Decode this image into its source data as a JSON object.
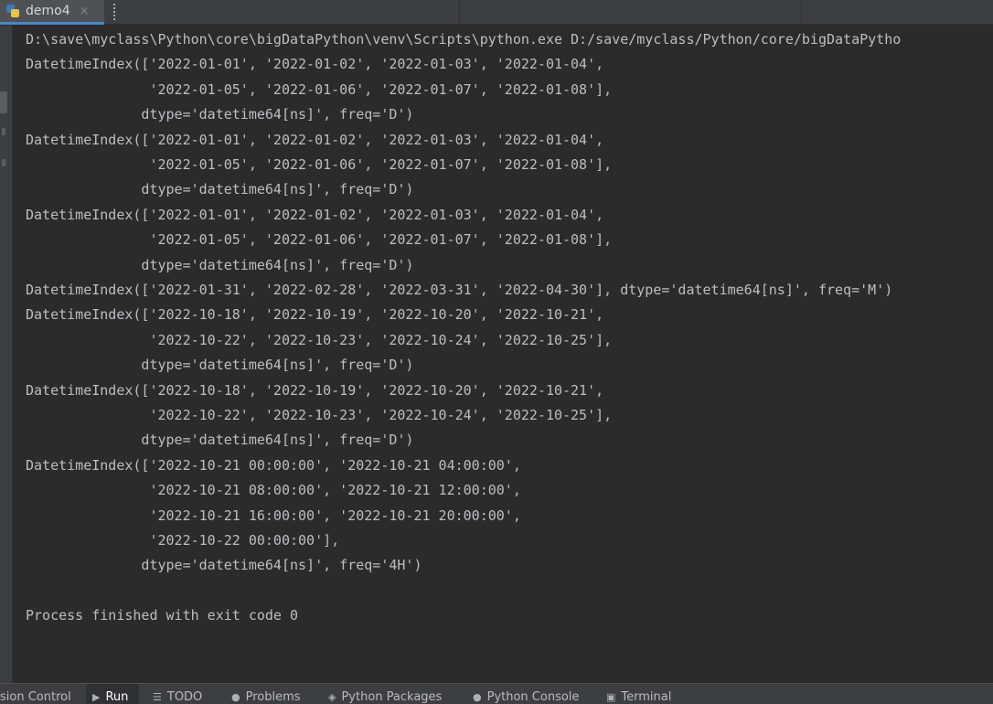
{
  "editor_tab": {
    "title": "demo4",
    "close": "×",
    "icon": "python-file-icon"
  },
  "console": {
    "lines": [
      "D:\\save\\myclass\\Python\\core\\bigDataPython\\venv\\Scripts\\python.exe D:/save/myclass/Python/core/bigDataPytho",
      "DatetimeIndex(['2022-01-01', '2022-01-02', '2022-01-03', '2022-01-04',",
      "               '2022-01-05', '2022-01-06', '2022-01-07', '2022-01-08'],",
      "              dtype='datetime64[ns]', freq='D')",
      "DatetimeIndex(['2022-01-01', '2022-01-02', '2022-01-03', '2022-01-04',",
      "               '2022-01-05', '2022-01-06', '2022-01-07', '2022-01-08'],",
      "              dtype='datetime64[ns]', freq='D')",
      "DatetimeIndex(['2022-01-01', '2022-01-02', '2022-01-03', '2022-01-04',",
      "               '2022-01-05', '2022-01-06', '2022-01-07', '2022-01-08'],",
      "              dtype='datetime64[ns]', freq='D')",
      "DatetimeIndex(['2022-01-31', '2022-02-28', '2022-03-31', '2022-04-30'], dtype='datetime64[ns]', freq='M')",
      "DatetimeIndex(['2022-10-18', '2022-10-19', '2022-10-20', '2022-10-21',",
      "               '2022-10-22', '2022-10-23', '2022-10-24', '2022-10-25'],",
      "              dtype='datetime64[ns]', freq='D')",
      "DatetimeIndex(['2022-10-18', '2022-10-19', '2022-10-20', '2022-10-21',",
      "               '2022-10-22', '2022-10-23', '2022-10-24', '2022-10-25'],",
      "              dtype='datetime64[ns]', freq='D')",
      "DatetimeIndex(['2022-10-21 00:00:00', '2022-10-21 04:00:00',",
      "               '2022-10-21 08:00:00', '2022-10-21 12:00:00',",
      "               '2022-10-21 16:00:00', '2022-10-21 20:00:00',",
      "               '2022-10-22 00:00:00'],",
      "              dtype='datetime64[ns]', freq='4H')",
      "",
      "Process finished with exit code 0"
    ]
  },
  "tool_windows": [
    {
      "label": "sion Control",
      "icon": "",
      "icon_name": "version-control-icon",
      "active": false
    },
    {
      "label": "Run",
      "icon": "▶",
      "icon_name": "run-icon",
      "active": true
    },
    {
      "label": "TODO",
      "icon": "☰",
      "icon_name": "todo-icon",
      "active": false
    },
    {
      "label": "Problems",
      "icon": "●",
      "icon_name": "problems-icon",
      "active": false
    },
    {
      "label": "Python Packages",
      "icon": "◈",
      "icon_name": "python-packages-icon",
      "active": false
    },
    {
      "label": "Python Console",
      "icon": "●",
      "icon_name": "python-console-icon",
      "active": false
    },
    {
      "label": "Terminal",
      "icon": "▣",
      "icon_name": "terminal-icon",
      "active": false
    }
  ]
}
